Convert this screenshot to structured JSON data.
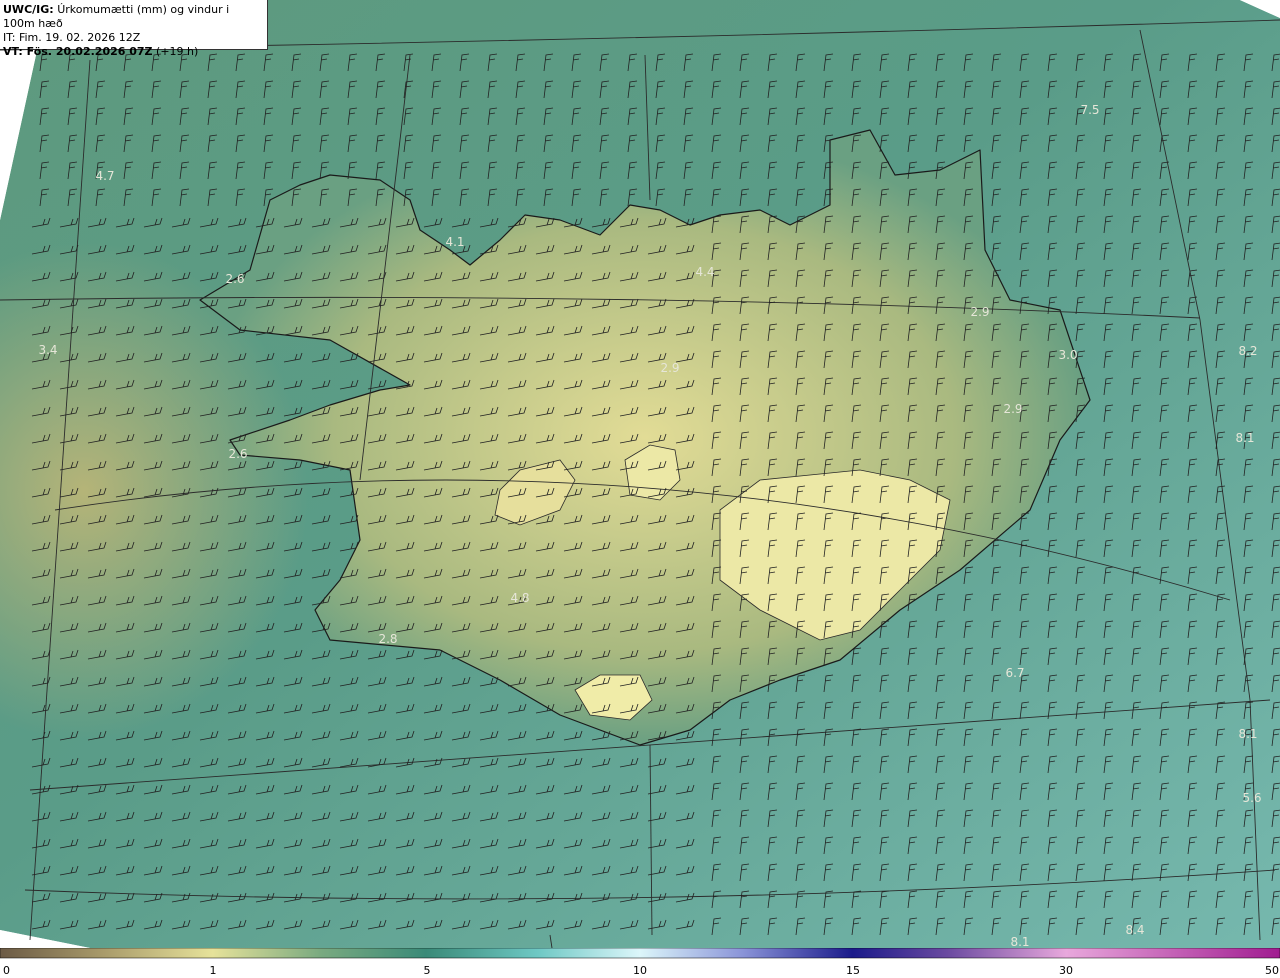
{
  "header": {
    "model": "UWC/IG:",
    "title": "Úrkomumætti (mm) og vindur i 100m hæð",
    "it_label": "IT: Fim. 19. 02. 2026 12Z",
    "vt_prefix": "VT: Fös. 20.02.2026 07Z",
    "vt_suffix": "(+19 h)"
  },
  "colorbar": {
    "ticks": [
      "0",
      "1",
      "5",
      "10",
      "15",
      "30",
      "50"
    ],
    "colors": [
      "#6b5a45",
      "#b8a76e",
      "#e6e29a",
      "#5a9a7a",
      "#3a8a78",
      "#7fd4d0",
      "#d8f4f8",
      "#7a84d0",
      "#2a2a9a",
      "#1a0a6a",
      "#b060b0",
      "#e8a0d8",
      "#a02090"
    ]
  },
  "map_values": [
    "7.5",
    "4.7",
    "3.4",
    "2.6",
    "2.6",
    "2.9",
    "2.9",
    "2.9",
    "2.8",
    "4.8",
    "6.7",
    "5.6",
    "8.2",
    "8.1",
    "8.1",
    "3.0",
    "4.4",
    "4.1",
    "8.4",
    "8.1"
  ]
}
